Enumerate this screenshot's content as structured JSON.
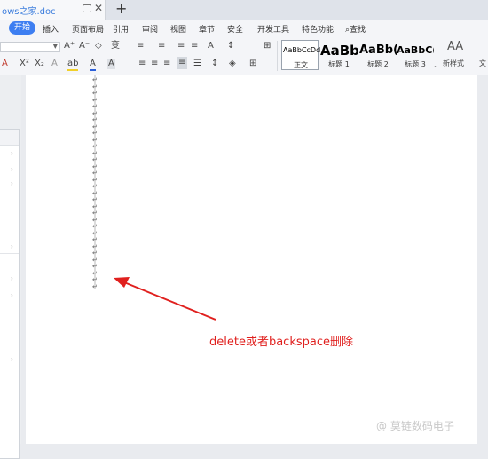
{
  "tab": {
    "name": "ows之家.doc",
    "close": "✕",
    "new": "+"
  },
  "menu": [
    "开始",
    "插入",
    "页面布局",
    "引用",
    "审阅",
    "视图",
    "章节",
    "安全",
    "开发工具",
    "特色功能",
    "查找"
  ],
  "ribbon": {
    "font_icons": [
      "A⁺",
      "A⁻",
      "◇",
      "变"
    ],
    "format_icons": [
      "A",
      "X²",
      "X₂",
      "A",
      "ab",
      "A",
      "A"
    ],
    "para_icons": [
      "≡",
      "≡",
      "≡",
      "≡",
      "A",
      "↕",
      "⊞"
    ],
    "styles": [
      {
        "preview": "AaBbCcDd",
        "name": "正文"
      },
      {
        "preview": "AaBb",
        "name": "标题 1"
      },
      {
        "preview": "AaBb(",
        "name": "标题 2"
      },
      {
        "preview": "AaBbC(",
        "name": "标题 3"
      }
    ],
    "new_style": "新样式",
    "new_style_icon": "AA",
    "cut_off": "文"
  },
  "document": {
    "annotation": "delete或者backspace删除",
    "paragraph_mark": "↵",
    "paragraph_count": 32
  },
  "watermark": "@ 莫链数码电子",
  "colors": {
    "accent": "#3d7ef1",
    "annotation": "#e0201e",
    "tab_text": "#3b7ddd"
  }
}
